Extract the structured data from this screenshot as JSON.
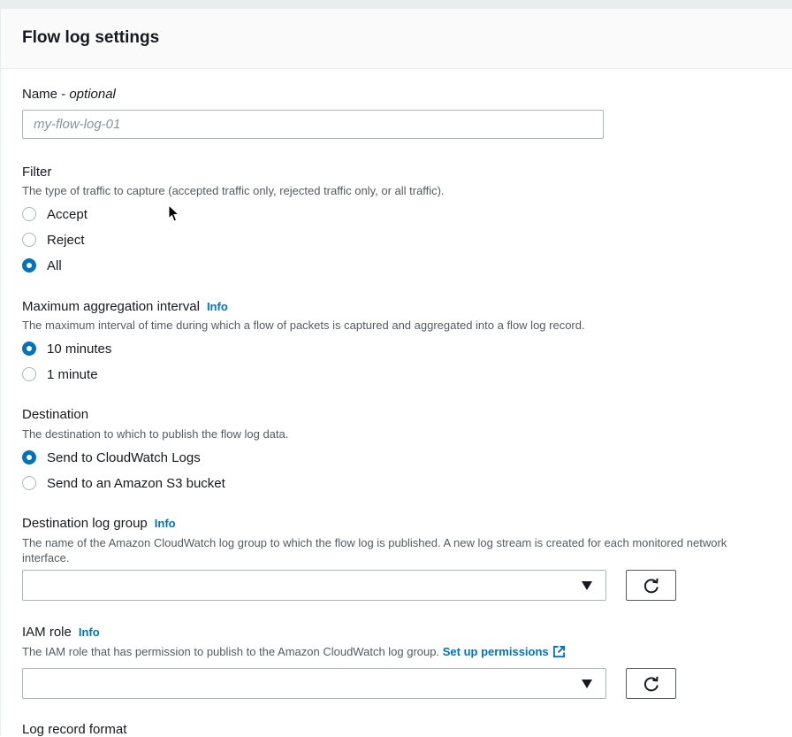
{
  "panel": {
    "title": "Flow log settings"
  },
  "name_field": {
    "label": "Name - ",
    "label_optional": "optional",
    "placeholder": "my-flow-log-01"
  },
  "filter": {
    "label": "Filter",
    "description": "The type of traffic to capture (accepted traffic only, rejected traffic only, or all traffic).",
    "options": [
      {
        "label": "Accept",
        "checked": false
      },
      {
        "label": "Reject",
        "checked": false
      },
      {
        "label": "All",
        "checked": true
      }
    ]
  },
  "aggregation": {
    "label": "Maximum aggregation interval",
    "info": "Info",
    "description": "The maximum interval of time during which a flow of packets is captured and aggregated into a flow log record.",
    "options": [
      {
        "label": "10 minutes",
        "checked": true
      },
      {
        "label": "1 minute",
        "checked": false
      }
    ]
  },
  "destination": {
    "label": "Destination",
    "description": "The destination to which to publish the flow log data.",
    "options": [
      {
        "label": "Send to CloudWatch Logs",
        "checked": true
      },
      {
        "label": "Send to an Amazon S3 bucket",
        "checked": false
      }
    ]
  },
  "log_group": {
    "label": "Destination log group",
    "info": "Info",
    "description": "The name of the Amazon CloudWatch log group to which the flow log is published. A new log stream is created for each monitored network interface.",
    "value": ""
  },
  "iam_role": {
    "label": "IAM role",
    "info": "Info",
    "description": "The IAM role that has permission to publish to the Amazon CloudWatch log group.",
    "link": "Set up permissions",
    "value": ""
  },
  "log_format": {
    "label": "Log record format"
  },
  "colors": {
    "accent": "#0073bb",
    "text": "#16191f",
    "muted": "#545b64",
    "border": "#aab7b8"
  }
}
